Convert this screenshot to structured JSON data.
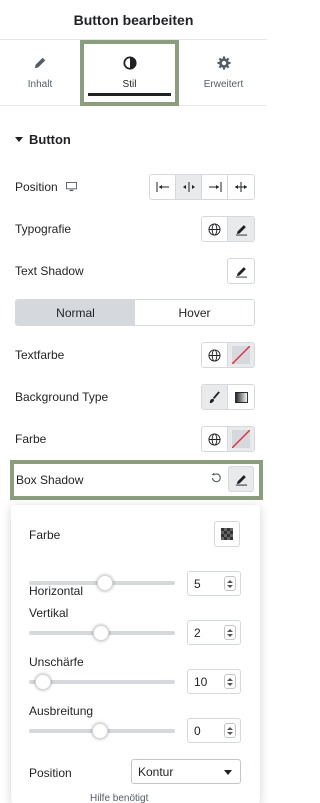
{
  "header": {
    "title": "Button bearbeiten"
  },
  "tabs": [
    {
      "label": "Inhalt",
      "icon": "pencil-icon"
    },
    {
      "label": "Stil",
      "icon": "contrast-icon"
    },
    {
      "label": "Erweitert",
      "icon": "gear-icon"
    }
  ],
  "section": {
    "title": "Button"
  },
  "controls": {
    "position_label": "Position",
    "typografie_label": "Typografie",
    "text_shadow_label": "Text Shadow",
    "state_normal": "Normal",
    "state_hover": "Hover",
    "textfarbe_label": "Textfarbe",
    "background_type_label": "Background Type",
    "farbe_label": "Farbe",
    "box_shadow_label": "Box Shadow"
  },
  "popover": {
    "farbe_label": "Farbe",
    "horizontal_label": "Horizontal",
    "horizontal_value": "5",
    "vertikal_label": "Vertikal",
    "vertikal_value": "2",
    "unschaerfe_label": "Unschärfe",
    "unschaerfe_value": "10",
    "ausbreitung_label": "Ausbreitung",
    "ausbreitung_value": "0",
    "position_label": "Position",
    "position_value": "Kontur"
  },
  "footer_hint": "Hilfe benötigt"
}
